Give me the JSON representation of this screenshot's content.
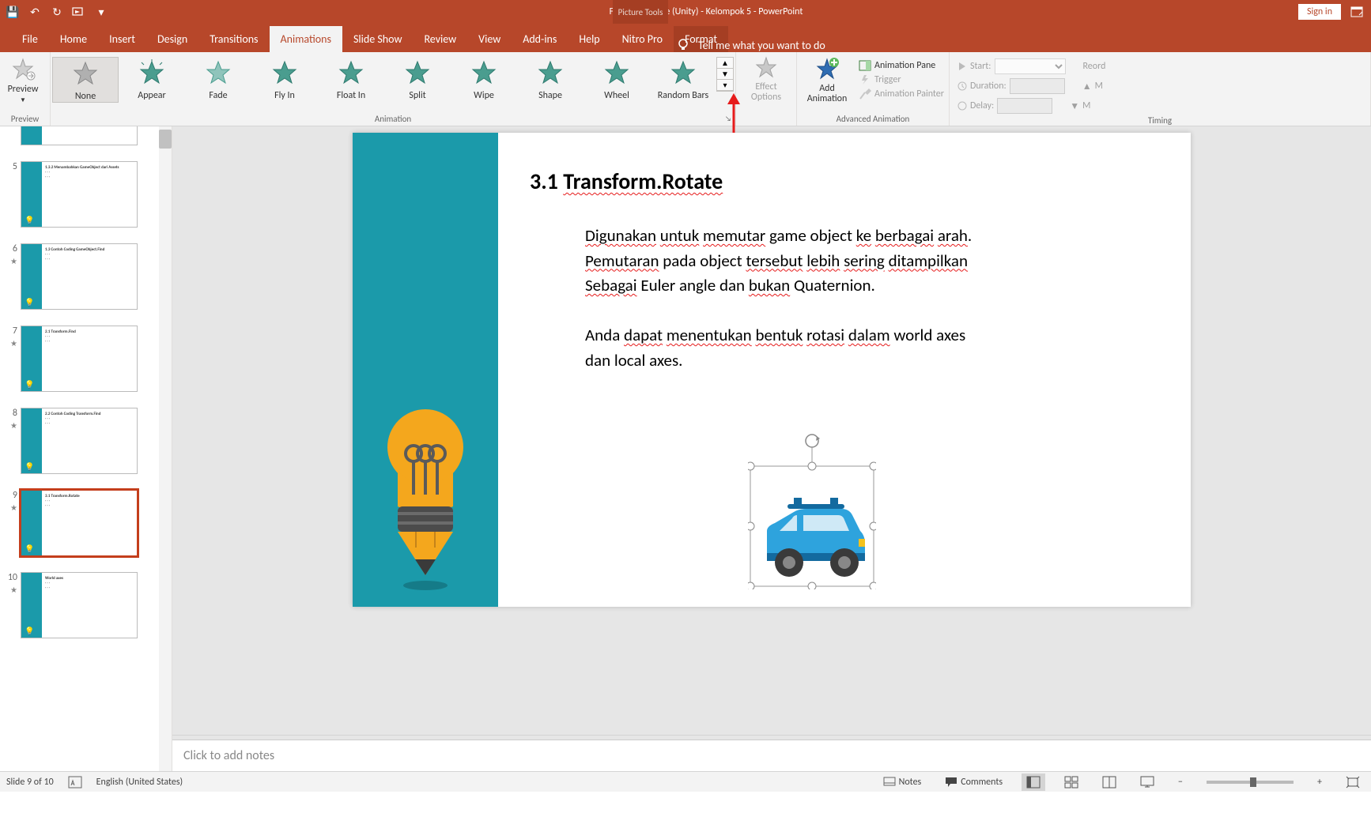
{
  "titlebar": {
    "app_title": "Find and Rotate (Unity) - Kelompok 5  -  PowerPoint",
    "contextual_tab_group": "Picture Tools",
    "sign_in": "Sign in"
  },
  "tabs": {
    "file": "File",
    "home": "Home",
    "insert": "Insert",
    "design": "Design",
    "transitions": "Transitions",
    "animations": "Animations",
    "slideshow": "Slide Show",
    "review": "Review",
    "view": "View",
    "addins": "Add-ins",
    "help": "Help",
    "nitro": "Nitro Pro",
    "format": "Format",
    "tellme": "Tell me what you want to do"
  },
  "ribbon": {
    "preview_label": "Preview",
    "preview_group": "Preview",
    "animation_group": "Animation",
    "advanced_group": "Advanced Animation",
    "timing_group": "Timing",
    "anims": {
      "none": "None",
      "appear": "Appear",
      "fade": "Fade",
      "flyin": "Fly In",
      "floatin": "Float In",
      "split": "Split",
      "wipe": "Wipe",
      "shape": "Shape",
      "wheel": "Wheel",
      "randombars": "Random Bars"
    },
    "effect_options": "Effect Options",
    "add_animation": "Add Animation",
    "animation_pane": "Animation Pane",
    "trigger": "Trigger",
    "animation_painter": "Animation Painter",
    "start": "Start:",
    "duration": "Duration:",
    "delay": "Delay:",
    "reorder": "Reord",
    "move_earlier_short": "M",
    "move_later_short": "M"
  },
  "thumbnails": {
    "items": [
      {
        "num": "5",
        "star": false,
        "title": "1.3.2 Menambahkan GameObject dari Assets"
      },
      {
        "num": "6",
        "star": true,
        "title": "1.3 Contoh Coding GameObject.Find"
      },
      {
        "num": "7",
        "star": true,
        "title": "2.1 Transform.Find"
      },
      {
        "num": "8",
        "star": true,
        "title": "2.2 Contoh Coding Transform.Find"
      },
      {
        "num": "9",
        "star": true,
        "title": "3.1 Transform.Rotate",
        "selected": true
      },
      {
        "num": "10",
        "star": true,
        "title": "World axes"
      }
    ]
  },
  "slide": {
    "heading_num": "3.1",
    "heading_text": "Transform.Rotate",
    "p1_w1": "Digunakan",
    "p1_w2": "untuk",
    "p1_w3": "memutar",
    "p1_plain1": "game object",
    "p1_w4": "ke",
    "p1_w5": "berbagai",
    "p1_w6": "arah",
    "p2_w1": "Pemutaran",
    "p2_plain1": "pada object",
    "p2_w2": "tersebut",
    "p2_w3": "lebih",
    "p2_w4": "sering",
    "p2_w5": "ditampilkan",
    "p3_w1": "Sebagai",
    "p3_plain1": "Euler angle dan",
    "p3_w2": "bukan",
    "p3_plain2": "Quaternion.",
    "p4_plain1": "Anda",
    "p4_w1": "dapat",
    "p4_w2": "menentukan",
    "p4_w3": "bentuk",
    "p4_w4": "rotasi",
    "p4_w5": "dalam",
    "p4_plain2": "world axes",
    "p5": "dan local axes."
  },
  "notes_placeholder": "Click to add notes",
  "status": {
    "slide_indicator": "Slide 9 of 10",
    "language": "English (United States)",
    "notes": "Notes",
    "comments": "Comments",
    "zoom_value": "",
    "zoom_pct": ""
  },
  "icons": {
    "save": "💾",
    "undo": "↶",
    "redo": "↻",
    "start_from_beginning": "▦",
    "qat_more": "▾",
    "ribbon_display": "⬜"
  }
}
